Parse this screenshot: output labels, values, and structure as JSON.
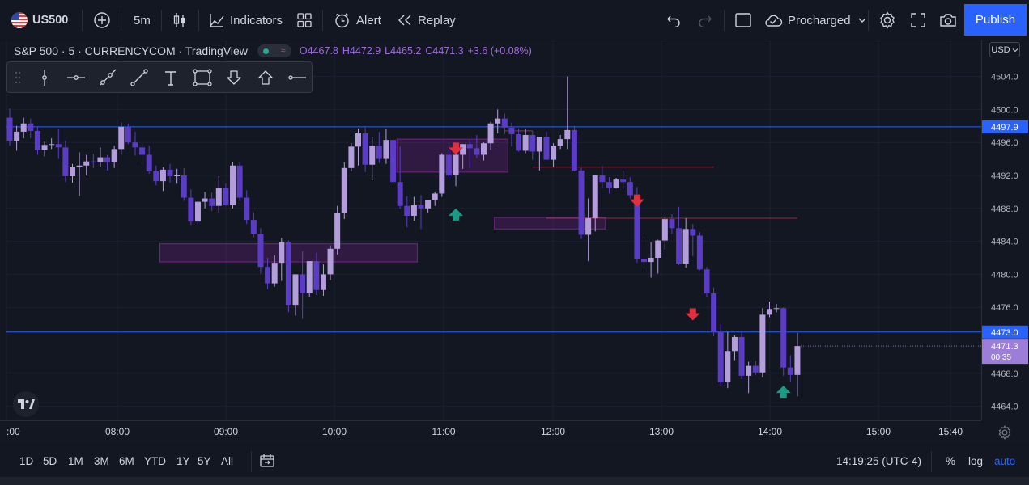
{
  "toolbar": {
    "symbol": "US500",
    "interval": "5m",
    "indicators_label": "Indicators",
    "alert_label": "Alert",
    "replay_label": "Replay",
    "layout_name": "Procharged",
    "publish_label": "Publish"
  },
  "legend": {
    "title": "S&P 500 · 5 · CURRENCYCOM · TradingView",
    "open": "O4467.8",
    "high": "H4472.9",
    "low": "L4465.2",
    "close": "C4471.3",
    "change": "+3.6 (+0.08%)"
  },
  "currency_label": "USD",
  "price_axis": {
    "ticks": [
      "4504.0",
      "4500.0",
      "4496.0",
      "4492.0",
      "4488.0",
      "4484.0",
      "4480.0",
      "4476.0",
      "4468.0",
      "4464.0"
    ],
    "line_label_upper": "4497.9",
    "line_label_lower": "4473.0",
    "last_price": "4471.3",
    "countdown": "00:35"
  },
  "time_axis": {
    "ticks": [
      ":00",
      "08:00",
      "09:00",
      "10:00",
      "11:00",
      "12:00",
      "13:00",
      "14:00",
      "15:00",
      "15:40"
    ]
  },
  "ranges": [
    "1D",
    "5D",
    "1M",
    "3M",
    "6M",
    "YTD",
    "1Y",
    "5Y",
    "All"
  ],
  "clock": "14:19:25 (UTC-4)",
  "scale_options": {
    "percent": "%",
    "log": "log",
    "auto": "auto"
  },
  "colors": {
    "background": "#131722",
    "up_candle": "#b39ddb",
    "down_candle": "#5b3cc4",
    "horizontal_line": "#2962ff",
    "zone_fill": "#9c27b0",
    "down_arrow": "#e0303f",
    "up_arrow": "#199c86",
    "accent": "#2962ff"
  },
  "chart_data": {
    "type": "candlestick",
    "symbol": "S&P 500",
    "interval": "5",
    "ylim": [
      4462,
      4506
    ],
    "candles": [
      [
        4499.0,
        4500.1,
        4495.6,
        4496.2
      ],
      [
        4496.2,
        4498.0,
        4495.0,
        4497.3
      ],
      [
        4497.3,
        4499.0,
        4496.5,
        4498.3
      ],
      [
        4498.3,
        4498.9,
        4496.5,
        4497.4
      ],
      [
        4497.4,
        4497.9,
        4494.5,
        4495.1
      ],
      [
        4495.1,
        4496.1,
        4494.3,
        4495.7
      ],
      [
        4495.7,
        4496.5,
        4495.2,
        4495.8
      ],
      [
        4495.8,
        4497.6,
        4494.0,
        4495.4
      ],
      [
        4495.4,
        4496.2,
        4491.2,
        4491.9
      ],
      [
        4491.9,
        4493.4,
        4491.1,
        4493.0
      ],
      [
        4493.0,
        4494.8,
        4489.5,
        4493.2
      ],
      [
        4493.2,
        4494.5,
        4492.0,
        4493.7
      ],
      [
        4493.7,
        4494.6,
        4492.9,
        4493.6
      ],
      [
        4493.6,
        4495.4,
        4493.0,
        4494.2
      ],
      [
        4494.2,
        4494.5,
        4492.6,
        4493.6
      ],
      [
        4493.6,
        4495.6,
        4492.9,
        4495.2
      ],
      [
        4495.2,
        4498.4,
        4494.5,
        4497.9
      ],
      [
        4497.9,
        4498.3,
        4495.8,
        4496.0
      ],
      [
        4496.0,
        4497.3,
        4494.4,
        4495.4
      ],
      [
        4495.4,
        4495.9,
        4493.3,
        4494.5
      ],
      [
        4494.5,
        4495.6,
        4492.2,
        4492.5
      ],
      [
        4492.5,
        4493.2,
        4490.8,
        4491.3
      ],
      [
        4491.3,
        4493.0,
        4490.1,
        4492.7
      ],
      [
        4492.7,
        4493.4,
        4491.1,
        4491.9
      ],
      [
        4491.9,
        4492.8,
        4491.0,
        4492.0
      ],
      [
        4492.0,
        4492.9,
        4488.9,
        4489.3
      ],
      [
        4489.3,
        4490.3,
        4486.0,
        4486.4
      ],
      [
        4486.4,
        4488.9,
        4486.0,
        4488.8
      ],
      [
        4488.8,
        4490.0,
        4488.0,
        4489.2
      ],
      [
        4489.2,
        4489.9,
        4487.7,
        4488.3
      ],
      [
        4488.3,
        4491.9,
        4487.5,
        4490.5
      ],
      [
        4490.5,
        4491.0,
        4488.3,
        4488.4
      ],
      [
        4488.4,
        4493.6,
        4488.0,
        4493.2
      ],
      [
        4493.2,
        4493.6,
        4488.9,
        4489.3
      ],
      [
        4489.3,
        4490.2,
        4486.1,
        4486.6
      ],
      [
        4486.6,
        4487.5,
        4484.5,
        4484.9
      ],
      [
        4484.9,
        4485.6,
        4480.1,
        4480.9
      ],
      [
        4480.9,
        4482.0,
        4478.2,
        4478.9
      ],
      [
        4478.9,
        4482.3,
        4478.5,
        4481.4
      ],
      [
        4481.4,
        4484.4,
        4479.2,
        4483.9
      ],
      [
        4483.9,
        4484.1,
        4475.4,
        4476.3
      ],
      [
        4476.3,
        4480.0,
        4475.0,
        4480.0
      ],
      [
        4480.0,
        4482.8,
        4474.6,
        4477.7
      ],
      [
        4477.7,
        4481.6,
        4477.3,
        4481.6
      ],
      [
        4481.6,
        4482.6,
        4477.5,
        4478.1
      ],
      [
        4478.1,
        4481.2,
        4477.4,
        4480.0
      ],
      [
        4480.0,
        4483.5,
        4479.3,
        4483.1
      ],
      [
        4483.1,
        4488.3,
        4482.4,
        4487.4
      ],
      [
        4487.4,
        4493.6,
        4486.7,
        4492.9
      ],
      [
        4492.9,
        4495.9,
        4492.5,
        4495.5
      ],
      [
        4495.5,
        4497.7,
        4493.2,
        4497.1
      ],
      [
        4497.1,
        4497.8,
        4492.4,
        4493.3
      ],
      [
        4493.3,
        4496.7,
        4491.4,
        4495.6
      ],
      [
        4495.6,
        4497.3,
        4493.5,
        4494.0
      ],
      [
        4494.0,
        4497.6,
        4493.4,
        4496.3
      ],
      [
        4496.3,
        4496.8,
        4491.0,
        4491.2
      ],
      [
        4491.2,
        4495.5,
        4488.0,
        4488.3
      ],
      [
        4488.3,
        4489.5,
        4485.7,
        4487.1
      ],
      [
        4487.1,
        4489.4,
        4486.5,
        4488.4
      ],
      [
        4488.4,
        4489.6,
        4485.5,
        4488.0
      ],
      [
        4488.0,
        4489.0,
        4487.5,
        4489.0
      ],
      [
        4489.0,
        4490.0,
        4488.3,
        4489.8
      ],
      [
        4489.8,
        4494.7,
        4489.4,
        4494.5
      ],
      [
        4494.5,
        4495.1,
        4491.5,
        4492.0
      ],
      [
        4492.0,
        4494.6,
        4490.7,
        4494.5
      ],
      [
        4494.5,
        4495.5,
        4492.8,
        4495.8
      ],
      [
        4495.8,
        4496.4,
        4492.9,
        4495.3
      ],
      [
        4495.3,
        4496.9,
        4494.1,
        4494.5
      ],
      [
        4494.5,
        4496.0,
        4493.8,
        4495.9
      ],
      [
        4495.9,
        4498.5,
        4495.1,
        4498.3
      ],
      [
        4498.3,
        4500.0,
        4497.1,
        4498.9
      ],
      [
        4498.9,
        4499.5,
        4497.0,
        4497.8
      ],
      [
        4497.8,
        4498.4,
        4495.5,
        4497.0
      ],
      [
        4497.0,
        4497.7,
        4494.9,
        4495.0
      ],
      [
        4495.0,
        4497.6,
        4494.7,
        4496.9
      ],
      [
        4496.9,
        4497.4,
        4493.9,
        4494.9
      ],
      [
        4494.9,
        4496.5,
        4492.6,
        4496.7
      ],
      [
        4496.7,
        4497.3,
        4494.1,
        4493.9
      ],
      [
        4493.9,
        4495.9,
        4493.0,
        4495.6
      ],
      [
        4495.6,
        4496.9,
        4495.2,
        4496.4
      ],
      [
        4496.4,
        4504.0,
        4495.2,
        4497.5
      ],
      [
        4497.5,
        4498.0,
        4492.5,
        4492.6
      ],
      [
        4492.6,
        4492.9,
        4484.3,
        4484.8
      ],
      [
        4484.8,
        4489.2,
        4481.6,
        4486.8
      ],
      [
        4486.8,
        4492.1,
        4485.2,
        4492.0
      ],
      [
        4492.0,
        4493.2,
        4490.5,
        4491.2
      ],
      [
        4491.2,
        4491.8,
        4489.8,
        4490.5
      ],
      [
        4490.5,
        4491.7,
        4490.4,
        4491.5
      ],
      [
        4491.5,
        4492.6,
        4490.4,
        4491.2
      ],
      [
        4491.2,
        4491.8,
        4489.2,
        4489.6
      ],
      [
        4489.6,
        4490.6,
        4481.4,
        4481.9
      ],
      [
        4481.9,
        4484.6,
        4480.7,
        4481.5
      ],
      [
        4481.5,
        4483.9,
        4479.6,
        4482.0
      ],
      [
        4482.0,
        4484.2,
        4480.1,
        4484.1
      ],
      [
        4484.1,
        4486.9,
        4483.0,
        4486.7
      ],
      [
        4486.7,
        4487.3,
        4484.9,
        4485.6
      ],
      [
        4485.6,
        4488.2,
        4481.1,
        4481.3
      ],
      [
        4481.3,
        4486.8,
        4480.8,
        4485.5
      ],
      [
        4485.5,
        4486.1,
        4482.2,
        4484.7
      ],
      [
        4484.7,
        4485.1,
        4480.5,
        4480.6
      ],
      [
        4480.6,
        4480.9,
        4477.3,
        4477.7
      ],
      [
        4477.7,
        4478.4,
        4472.5,
        4473.0
      ],
      [
        4473.0,
        4474.0,
        4466.5,
        4466.9
      ],
      [
        4466.9,
        4473.0,
        4466.2,
        4470.7
      ],
      [
        4470.7,
        4472.6,
        4469.6,
        4472.4
      ],
      [
        4472.4,
        4473.1,
        4467.3,
        4467.7
      ],
      [
        4467.7,
        4469.4,
        4465.6,
        4468.9
      ],
      [
        4468.9,
        4469.5,
        4467.8,
        4468.1
      ],
      [
        4468.1,
        4475.9,
        4467.5,
        4475.1
      ],
      [
        4475.1,
        4476.7,
        4474.8,
        4475.8
      ],
      [
        4475.8,
        4476.4,
        4475.4,
        4475.9
      ],
      [
        4475.9,
        4476.0,
        4467.7,
        4468.7
      ],
      [
        4468.7,
        4470.2,
        4467.0,
        4467.8
      ],
      [
        4467.8,
        4472.9,
        4465.2,
        4471.3
      ]
    ],
    "horizontal_lines": [
      4497.9,
      4473.0
    ],
    "zones": [
      {
        "start": 56,
        "end": 71,
        "top": 4496.4,
        "bottom": 4492.4
      },
      {
        "start": 70,
        "end": 85,
        "top": 4486.9,
        "bottom": 4485.5
      },
      {
        "start": 22,
        "end": 58,
        "top": 4483.7,
        "bottom": 4481.5
      }
    ],
    "markers": [
      {
        "index": 64,
        "type": "down",
        "price": 4494.9
      },
      {
        "index": 64,
        "type": "up",
        "price": 4487.6
      },
      {
        "index": 90,
        "type": "down",
        "price": 4488.6
      },
      {
        "index": 98,
        "type": "down",
        "price": 4474.8
      },
      {
        "index": 111,
        "type": "up",
        "price": 4466.1
      }
    ]
  }
}
